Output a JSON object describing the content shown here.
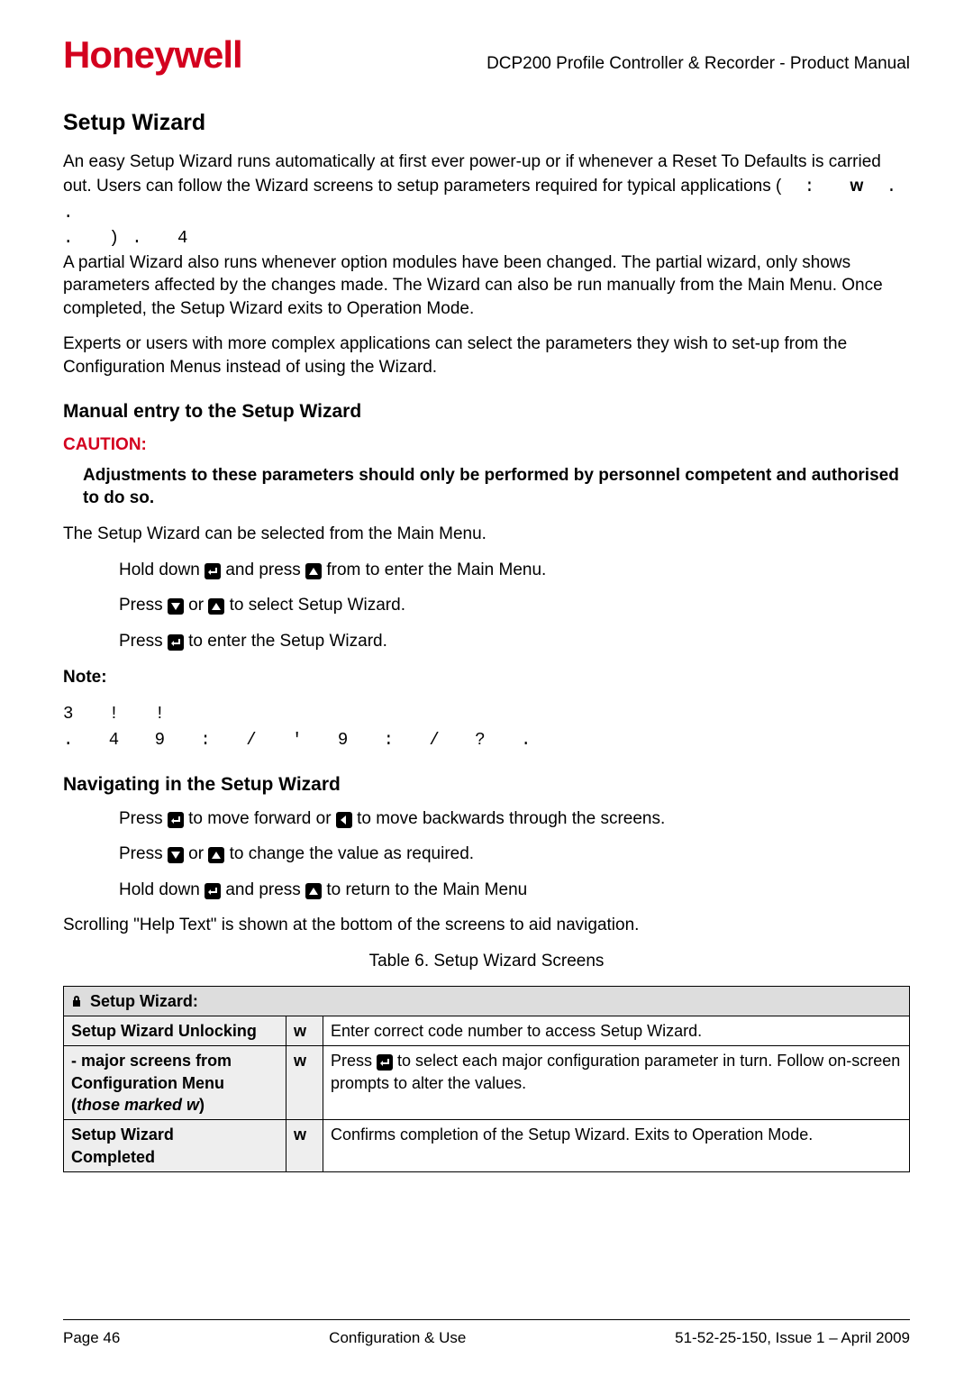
{
  "brand": "Honeywell",
  "header_title": "DCP200 Profile Controller & Recorder - Product Manual",
  "h1": "Setup Wizard",
  "para1a": "An easy Setup Wizard runs automatically at first ever power-up or if whenever a Reset To Defaults is carried out. Users can follow the Wizard screens to setup parameters required for typical applications (",
  "para1_inner1": "            : ",
  "para1_w": "w",
  "para1_inner2": "              .       .",
  "para1_line2": "                       .          ). 4",
  "para1b": "A partial Wizard also runs whenever option modules have been changed. The partial wizard, only shows parameters affected by the changes made. The Wizard can also be run manually from the Main Menu. Once completed, the Setup Wizard exits to Operation Mode.",
  "para2": "Experts or users with more complex applications can select the parameters they wish to set-up from the Configuration Menus instead of using the Wizard.",
  "h2_manual": "Manual entry to the Setup Wizard",
  "caution_label": "CAUTION:",
  "caution_text": "Adjustments to these parameters should only be performed by personnel competent and authorised to do so.",
  "manual_intro": "The Setup Wizard can be selected from the Main Menu.",
  "step_m1_a": "Hold down ",
  "step_m1_b": " and press ",
  "step_m1_c": " from to enter the Main Menu.",
  "step_m2_a": "Press ",
  "step_m2_b": "  or ",
  "step_m2_c": "  to select Setup Wizard.",
  "step_m3_a": "Press ",
  "step_m3_b": "  to enter the Setup Wizard.",
  "note_label": "Note:",
  "note_line1": "        3                    !                        !",
  "note_line2": ".     4   9   :  /    '            9   :  /    ?                .",
  "h2_nav": "Navigating in the Setup Wizard",
  "step_n1_a": "Press ",
  "step_n1_b": "  to move forward or ",
  "step_n1_c": "  to move backwards through the screens.",
  "step_n2_a": "Press ",
  "step_n2_b": "  or ",
  "step_n2_c": "  to change the value as required.",
  "step_n3_a": "Hold down ",
  "step_n3_b": " and press ",
  "step_n3_c": " to return to the Main Menu",
  "help_text": "Scrolling \"Help Text\" is shown at the bottom of the screens to aid navigation.",
  "table_caption": "Table 6.   Setup Wizard Screens",
  "table": {
    "header": "Setup Wizard:",
    "rows": [
      {
        "label": "Setup Wizard Unlocking",
        "w": "w",
        "desc": "Enter correct code number to access Setup Wizard."
      },
      {
        "label_line1": "  - major screens from",
        "label_line2": "Configuration Menu",
        "label_line3_a": "(",
        "label_line3_b": "those marked w",
        "label_line3_c": ")",
        "w": "w",
        "desc_a": "Press ",
        "desc_b": " to select each major configuration parameter in turn. Follow on-screen prompts to alter the values."
      },
      {
        "label_line1": "Setup Wizard",
        "label_line2": "Completed",
        "w": "w",
        "desc": "Confirms completion of the Setup Wizard. Exits to Operation Mode."
      }
    ]
  },
  "footer": {
    "left": "Page 46",
    "center": "Configuration & Use",
    "right": "51-52-25-150, Issue 1 – April 2009"
  },
  "icons": {
    "enter": "enter-key-icon",
    "up": "up-arrow-icon",
    "down": "down-arrow-icon",
    "left": "left-arrow-icon",
    "lock": "lock-icon"
  }
}
